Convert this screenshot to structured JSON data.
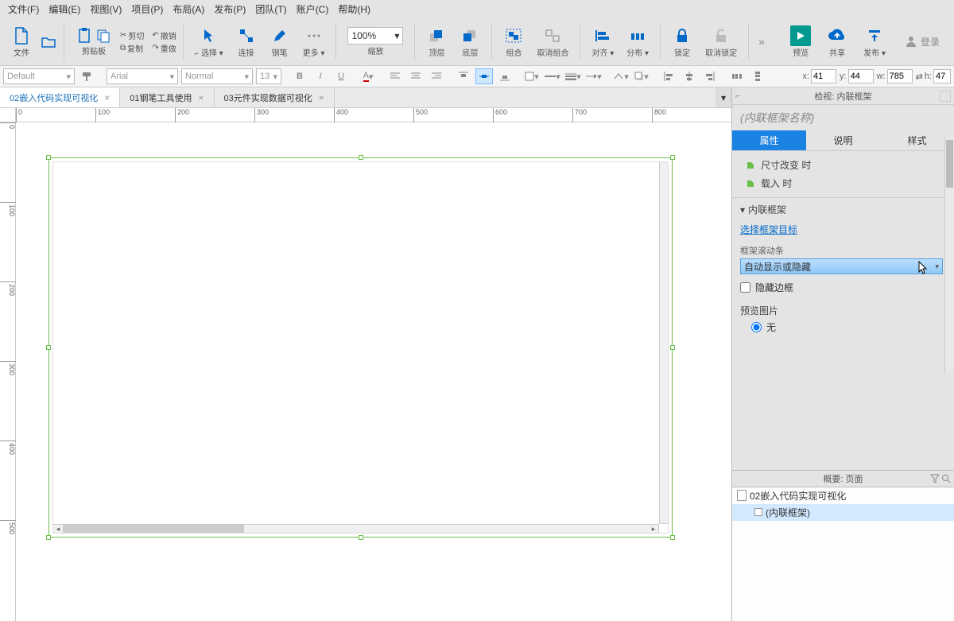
{
  "menu": [
    "文件(F)",
    "编辑(E)",
    "视图(V)",
    "项目(P)",
    "布局(A)",
    "发布(P)",
    "团队(T)",
    "账户(C)",
    "帮助(H)"
  ],
  "toolbar1": {
    "file": "文件",
    "clipboard": "剪贴板",
    "cut": "剪切",
    "copy": "复制",
    "paste": "粘贴",
    "undo": "撤销",
    "redo": "重做",
    "select": "选择",
    "connect": "连接",
    "pen": "钢笔",
    "more": "更多",
    "zoom_value": "100%",
    "zoom_group": "缩放",
    "front": "顶层",
    "back": "底层",
    "group": "组合",
    "ungroup": "取消组合",
    "align": "对齐",
    "distribute": "分布",
    "lock": "锁定",
    "unlock": "取消锁定",
    "preview": "预览",
    "share": "共享",
    "publish": "发布",
    "login": "登录",
    "overflow": "»"
  },
  "toolbar2": {
    "style": "Default",
    "font": "Arial",
    "weight": "Normal",
    "size": "13",
    "x_label": "x:",
    "x": "41",
    "y_label": "y:",
    "y": "44",
    "w_label": "w:",
    "w": "785",
    "h_label": "h:",
    "h": "47"
  },
  "tabs": [
    {
      "label": "02嵌入代码实现可视化",
      "active": true
    },
    {
      "label": "01钢笔工具使用",
      "active": false
    },
    {
      "label": "03元件实现数据可视化",
      "active": false
    }
  ],
  "ruler_h": [
    "0",
    "100",
    "200",
    "300",
    "400",
    "500",
    "600",
    "700",
    "800"
  ],
  "ruler_v": [
    "0",
    "100",
    "200",
    "300",
    "400",
    "500"
  ],
  "inspector": {
    "title": "检视: 内联框架",
    "name_placeholder": "(内联框架名称)",
    "tab_props": "属性",
    "tab_notes": "说明",
    "tab_style": "样式",
    "evt_resize": "尺寸改变 时",
    "evt_load": "载入 时",
    "section": "内联框架",
    "link": "选择框架目标",
    "scroll_label": "框架滚动条",
    "scroll_value": "自动显示或隐藏",
    "hide_border": "隐藏边框",
    "preview_label": "预览图片",
    "radio_none": "无"
  },
  "outline": {
    "title": "概要: 页面",
    "rows": [
      {
        "label": "02嵌入代码实现可视化",
        "icon": "page",
        "selected": false,
        "indent": 0
      },
      {
        "label": "(内联框架)",
        "icon": "check",
        "selected": true,
        "indent": 1
      }
    ]
  }
}
